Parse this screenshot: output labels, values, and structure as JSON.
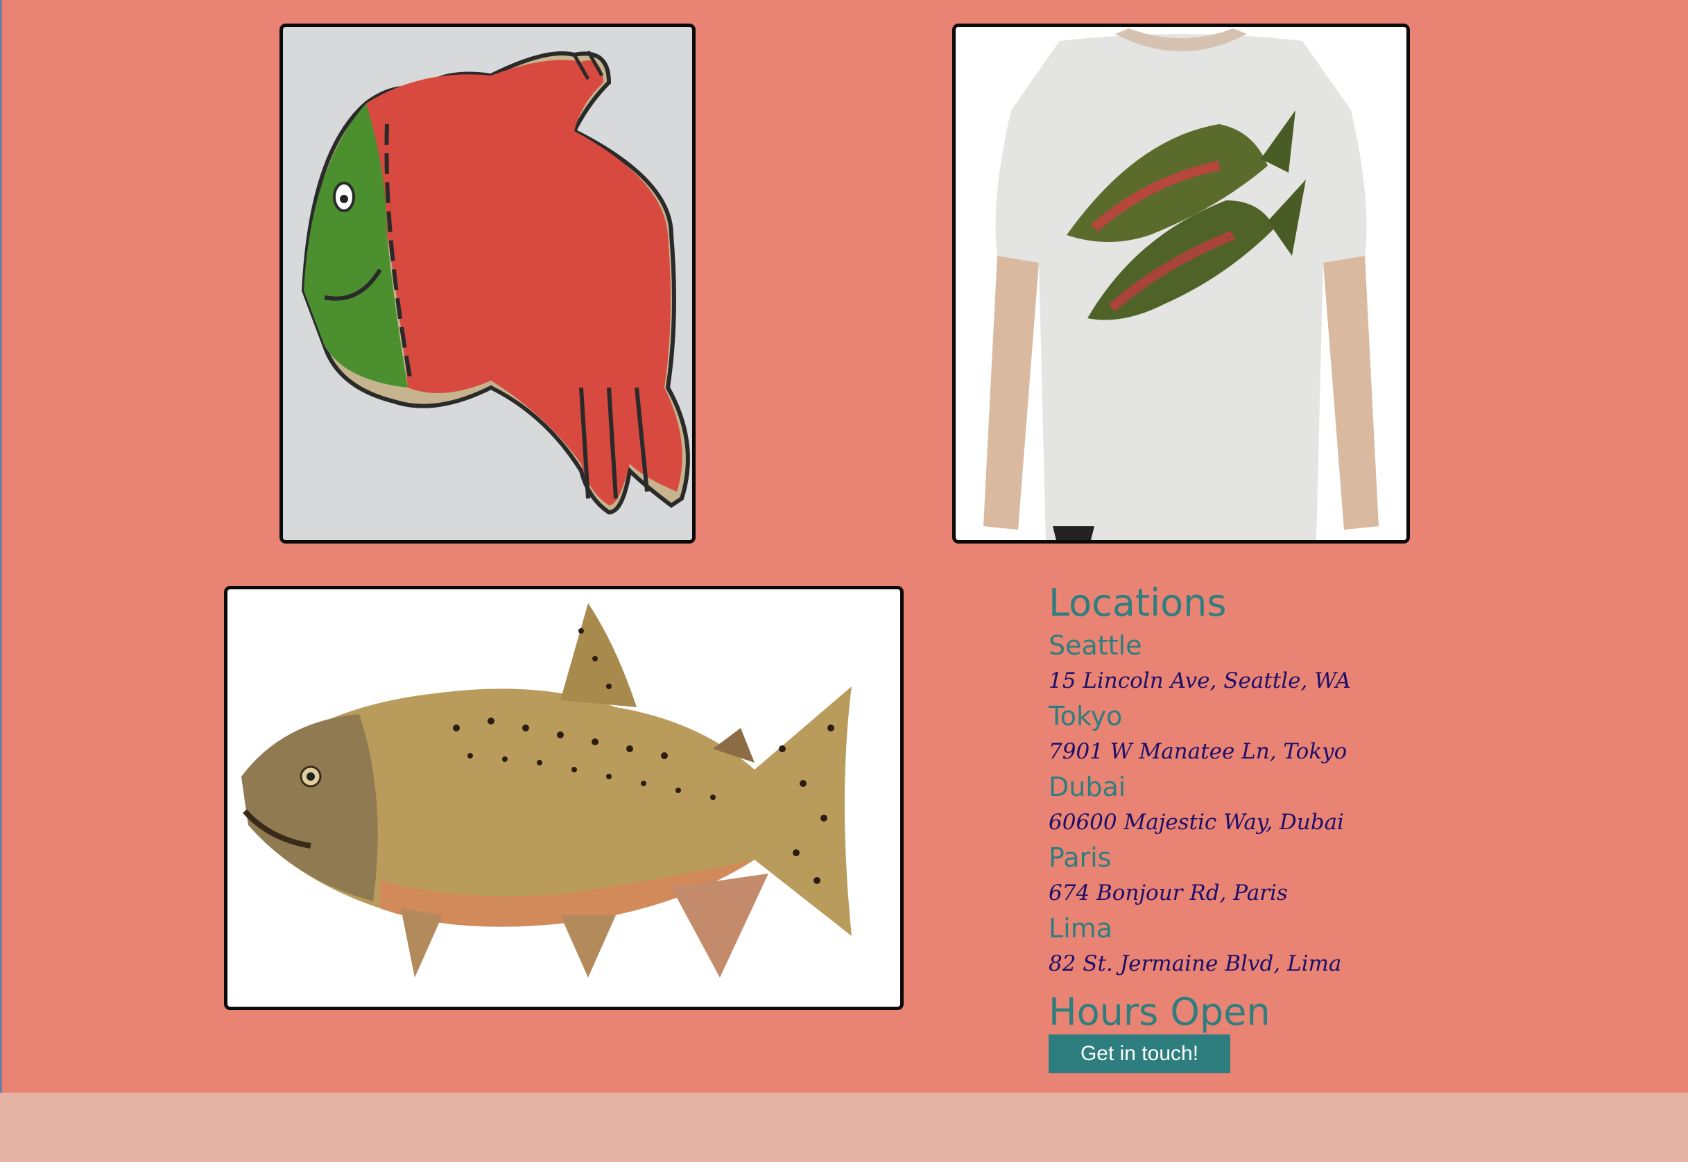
{
  "images": {
    "cookie": {
      "icon": "salmon-cookie-image"
    },
    "shirt": {
      "icon": "salmon-tshirt-image"
    },
    "fish": {
      "icon": "chinook-salmon-image"
    }
  },
  "locations": {
    "heading": "Locations",
    "items": [
      {
        "city": "Seattle",
        "address": "15 Lincoln Ave, Seattle, WA"
      },
      {
        "city": "Tokyo",
        "address": "7901 W Manatee Ln, Tokyo"
      },
      {
        "city": "Dubai",
        "address": "60600 Majestic Way, Dubai"
      },
      {
        "city": "Paris",
        "address": "674 Bonjour Rd, Paris"
      },
      {
        "city": "Lima",
        "address": "82 St. Jermaine Blvd, Lima"
      }
    ]
  },
  "hours": {
    "heading": "Hours Open"
  },
  "contact": {
    "button_label": "Get in touch!"
  },
  "colors": {
    "background": "#e98474",
    "heading": "#2f7e7f",
    "address": "#1d0e6b",
    "button": "#2f7e7f",
    "footer": "#e5b3a3"
  }
}
